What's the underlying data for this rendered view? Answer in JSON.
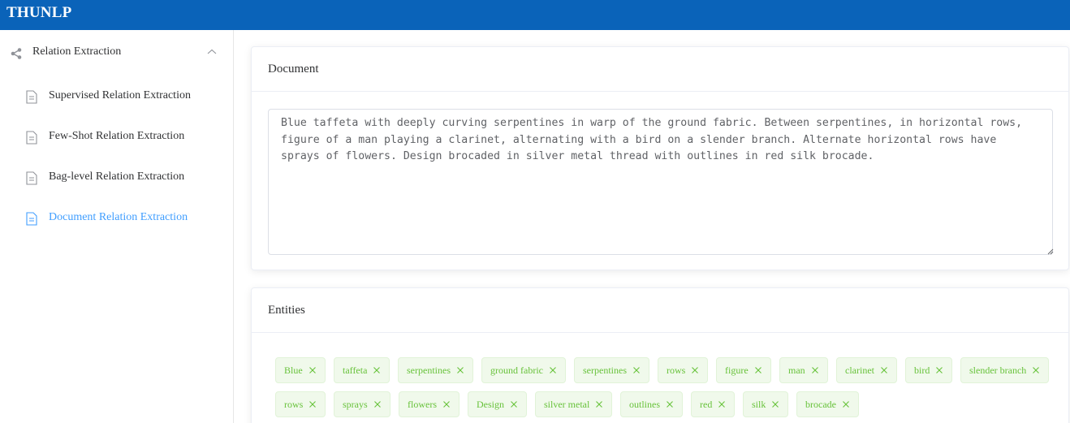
{
  "app": {
    "title": "THUNLP"
  },
  "sidebar": {
    "group": {
      "label": "Relation Extraction",
      "icon": "share-icon",
      "expanded": true
    },
    "items": [
      {
        "label": "Supervised Relation Extraction",
        "icon": "document-icon",
        "active": false
      },
      {
        "label": "Few-Shot Relation Extraction",
        "icon": "document-icon",
        "active": false
      },
      {
        "label": "Bag-level Relation Extraction",
        "icon": "document-icon",
        "active": false
      },
      {
        "label": "Document Relation Extraction",
        "icon": "document-icon",
        "active": true
      }
    ]
  },
  "document": {
    "title": "Document",
    "text": "Blue taffeta with deeply curving serpentines in warp of the ground fabric. Between serpentines, in horizontal rows, figure of a man playing a clarinet, alternating with a bird on a slender branch. Alternate horizontal rows have sprays of flowers. Design brocaded in silver metal thread with outlines in red silk brocade."
  },
  "entities": {
    "title": "Entities",
    "tags": [
      "Blue",
      "taffeta",
      "serpentines",
      "ground fabric",
      "serpentines",
      "rows",
      "figure",
      "man",
      "clarinet",
      "bird",
      "slender branch",
      "rows",
      "sprays",
      "flowers",
      "Design",
      "silver metal",
      "outlines",
      "red",
      "silk",
      "brocade"
    ]
  },
  "colors": {
    "topbar": "#0a63b9",
    "active": "#409eff",
    "tag_text": "#67c23a",
    "tag_bg": "#f0f9eb",
    "tag_border": "#e1f3d8"
  }
}
